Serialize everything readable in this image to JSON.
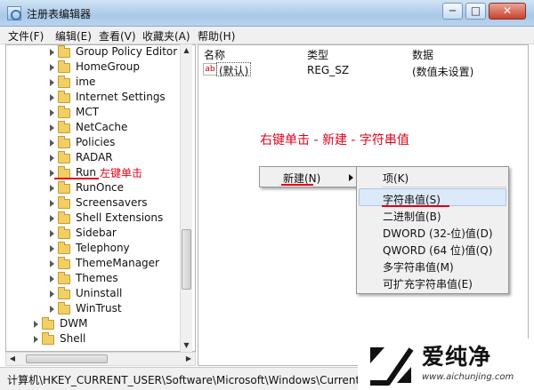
{
  "window": {
    "title": "注册表编辑器",
    "minimize_label": "─",
    "maximize_label": "□",
    "close_label": "✕"
  },
  "menubar": {
    "items": [
      {
        "label": "文件(F)"
      },
      {
        "label": "编辑(E)"
      },
      {
        "label": "查看(V)"
      },
      {
        "label": "收藏夹(A)"
      },
      {
        "label": "帮助(H)"
      }
    ]
  },
  "tree": {
    "items": [
      {
        "label": "Group Policy Editor"
      },
      {
        "label": "HomeGroup"
      },
      {
        "label": "ime"
      },
      {
        "label": "Internet Settings"
      },
      {
        "label": "MCT"
      },
      {
        "label": "NetCache"
      },
      {
        "label": "Policies"
      },
      {
        "label": "RADAR"
      },
      {
        "label": "Run"
      },
      {
        "label": "RunOnce"
      },
      {
        "label": "Screensavers"
      },
      {
        "label": "Shell Extensions"
      },
      {
        "label": "Sidebar"
      },
      {
        "label": "Telephony"
      },
      {
        "label": "ThemeManager"
      },
      {
        "label": "Themes"
      },
      {
        "label": "Uninstall"
      },
      {
        "label": "WinTrust"
      },
      {
        "label": "DWM"
      },
      {
        "label": "Shell"
      }
    ],
    "selected_annotation": "左键单击"
  },
  "values_pane": {
    "columns": [
      "名称",
      "类型",
      "数据"
    ],
    "rows": [
      {
        "icon_text": "ab",
        "name": "(默认)",
        "type": "REG_SZ",
        "data": "(数值未设置)"
      }
    ]
  },
  "annotation_right": "右键单击 - 新建 - 字符串值",
  "context_menu": {
    "item": "新建(N)"
  },
  "submenu": {
    "items": [
      {
        "label": "项(K)"
      },
      {
        "label": "字符串值(S)"
      },
      {
        "label": "二进制值(B)"
      },
      {
        "label": "DWORD (32-位)值(D)"
      },
      {
        "label": "QWORD (64 位)值(Q)"
      },
      {
        "label": "多字符串值(M)"
      },
      {
        "label": "可扩充字符串值(E)"
      }
    ],
    "highlighted": "字符串值(S)"
  },
  "statusbar": {
    "path": "计算机\\HKEY_CURRENT_USER\\Software\\Microsoft\\Windows\\CurrentV"
  },
  "watermark": {
    "name": "爱纯净",
    "url": "www.aichunjing.com"
  },
  "colors": {
    "annotation_red": "#e1001a",
    "folder_yellow": "#f1cf62",
    "highlight_blue": "#dce9f8"
  },
  "icons": {
    "app": "registry-editor-icon",
    "folder": "folder-icon",
    "expand": "expand-arrow-icon",
    "string_value": "string-value-icon",
    "submenu_arrow": "submenu-arrow-icon"
  }
}
